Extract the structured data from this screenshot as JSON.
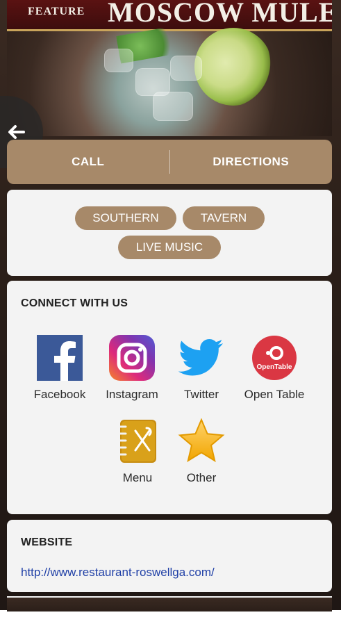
{
  "hero": {
    "feature": "FEATURE",
    "title": "MOSCOW MULE"
  },
  "actions": {
    "call": "CALL",
    "directions": "DIRECTIONS"
  },
  "tags": [
    "SOUTHERN",
    "TAVERN",
    "LIVE MUSIC"
  ],
  "connect": {
    "title": "CONNECT WITH US",
    "items": [
      {
        "label": "Facebook",
        "icon": "facebook-icon"
      },
      {
        "label": "Instagram",
        "icon": "instagram-icon"
      },
      {
        "label": "Twitter",
        "icon": "twitter-icon"
      },
      {
        "label": "Open Table",
        "icon": "opentable-icon"
      },
      {
        "label": "Menu",
        "icon": "menu-icon"
      },
      {
        "label": "Other",
        "icon": "star-icon"
      }
    ],
    "opentable_logo_text": "OpenTable"
  },
  "website": {
    "title": "WEBSITE",
    "url": "http://www.restaurant-roswellga.com/"
  },
  "colors": {
    "accent": "#a78969",
    "card": "#f3f3f3",
    "link": "#1f3fa6"
  }
}
